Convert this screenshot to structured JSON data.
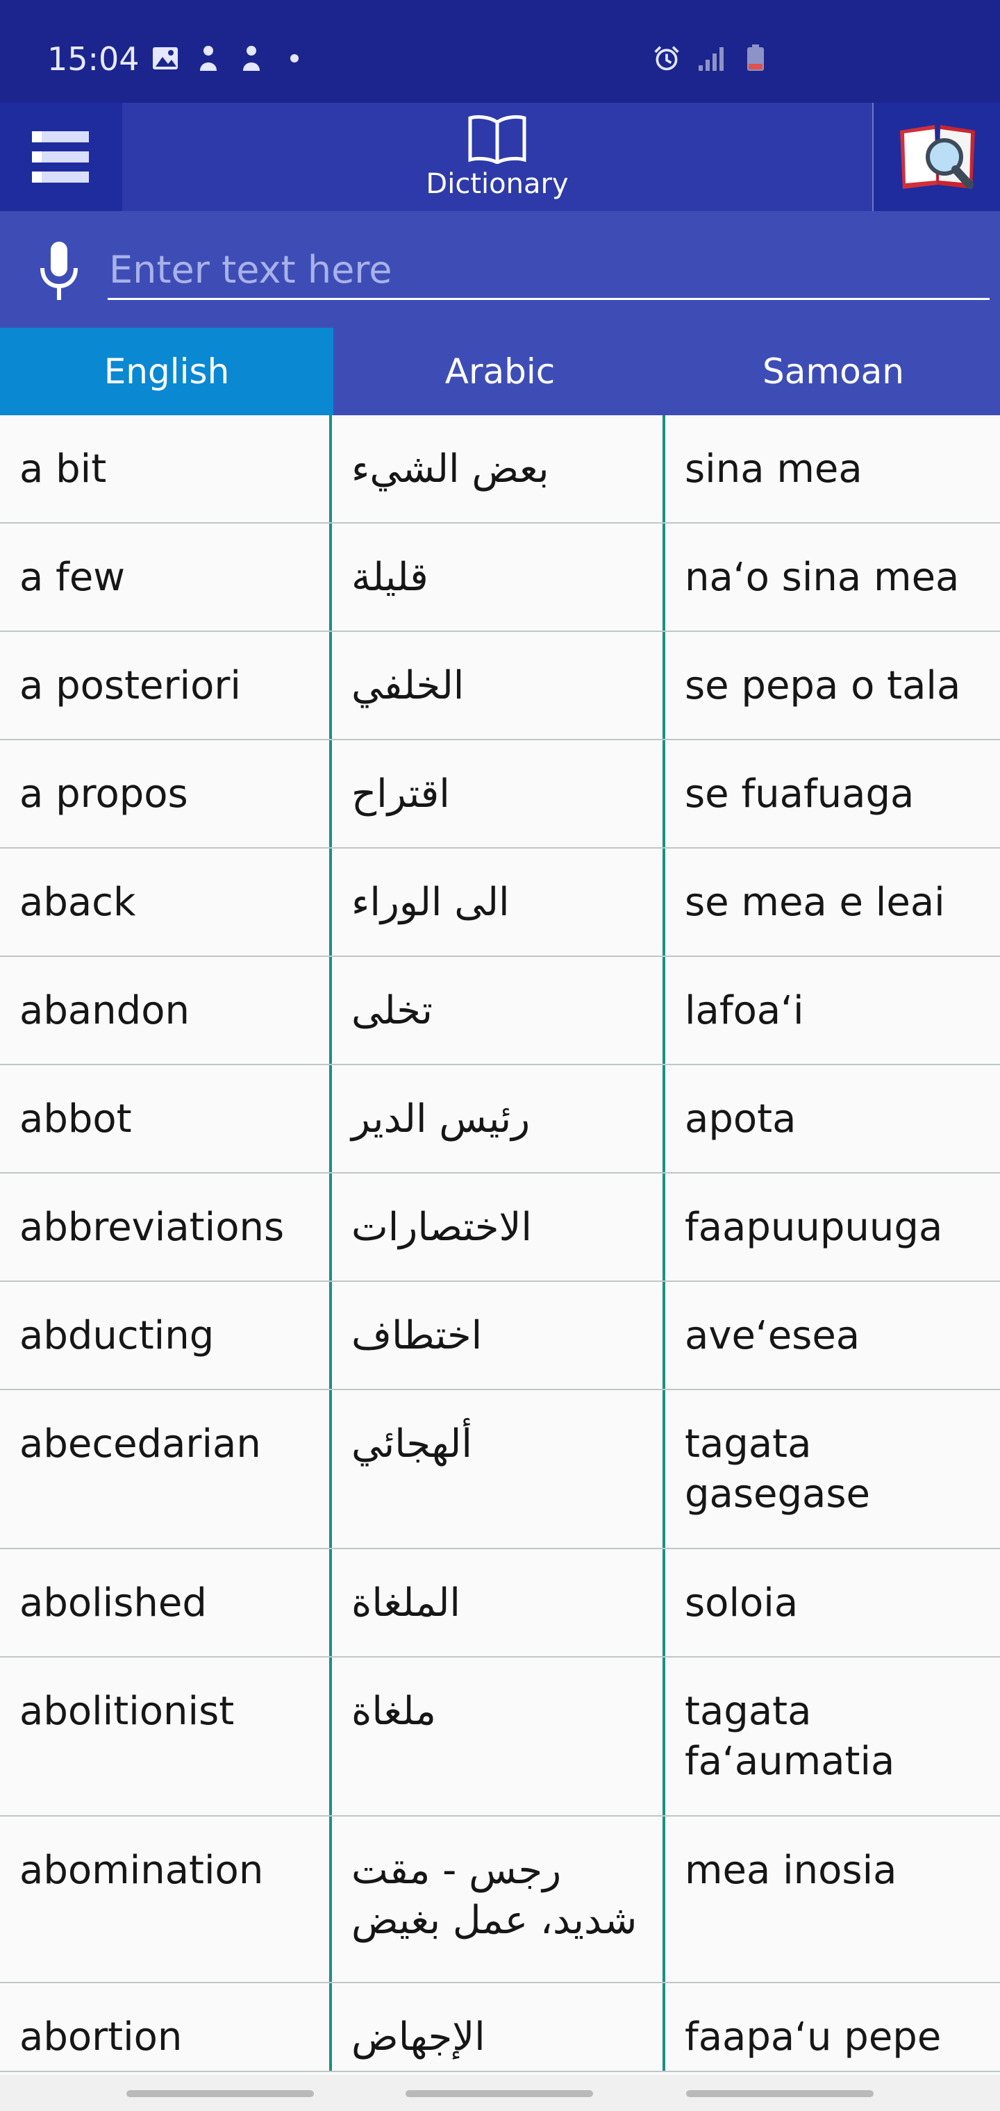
{
  "status_bar": {
    "time": "15:04",
    "left_icons": [
      "image-icon",
      "notification-icon",
      "notification-icon",
      "dot-icon"
    ],
    "right_icons": [
      "alarm-icon",
      "signal-icon",
      "battery-icon"
    ]
  },
  "app_bar": {
    "menu_icon": "menu-icon",
    "tab_label": "Dictionary",
    "tab_icon": "book-icon",
    "search_icon": "dictionary-search-icon"
  },
  "search": {
    "placeholder": "Enter text here",
    "value": ""
  },
  "language_tabs": [
    {
      "label": "English",
      "active": true
    },
    {
      "label": "Arabic",
      "active": false
    },
    {
      "label": "Samoan",
      "active": false
    }
  ],
  "entries": [
    {
      "english": "a bit",
      "arabic": "بعض الشيء",
      "samoan": "sina mea"
    },
    {
      "english": "a few",
      "arabic": "قليلة",
      "samoan": "na‘o sina mea"
    },
    {
      "english": "a posteriori",
      "arabic": "الخلفي",
      "samoan": "se pepa o tala"
    },
    {
      "english": "a propos",
      "arabic": "اقتراح",
      "samoan": "se fuafuaga"
    },
    {
      "english": "aback",
      "arabic": "الى الوراء",
      "samoan": "se mea e leai"
    },
    {
      "english": "abandon",
      "arabic": "تخلى",
      "samoan": "lafoa‘i"
    },
    {
      "english": "abbot",
      "arabic": "رئيس الدير",
      "samoan": "apota"
    },
    {
      "english": "abbreviations",
      "arabic": "الاختصارات",
      "samoan": "faapuupuuga"
    },
    {
      "english": "abducting",
      "arabic": "اختطاف",
      "samoan": "ave‘esea"
    },
    {
      "english": "abecedarian",
      "arabic": "ألهجائي",
      "samoan": "tagata gasegase"
    },
    {
      "english": "abolished",
      "arabic": "الملغاة",
      "samoan": "soloia"
    },
    {
      "english": "abolitionist",
      "arabic": "ملغاة",
      "samoan": "tagata fa‘aumatia"
    },
    {
      "english": "abomination",
      "arabic": "رجس - مقت شديد، عمل بغيض",
      "samoan": "mea inosia"
    },
    {
      "english": "abortion",
      "arabic": "الإجهاض",
      "samoan": "faapa‘u pepe"
    }
  ],
  "colors": {
    "status_bar": "#1b258d",
    "app_bar": "#1f2c9e",
    "search_bar": "#3e4db6",
    "active_tab": "#0a88d2",
    "column_divider": "#1b8f85"
  }
}
